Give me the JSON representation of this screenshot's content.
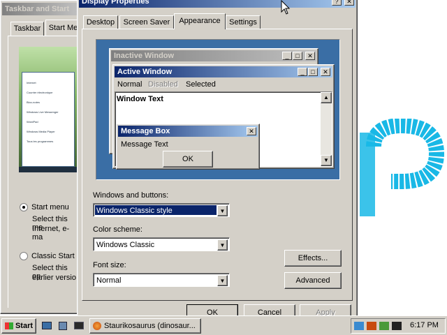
{
  "background_window": {
    "title": "Taskbar and Start",
    "tabs": [
      "Taskbar",
      "Start Me"
    ],
    "preview_menu_items": [
      "Internet",
      "Courrier électronique",
      "Bloc-notes",
      "Windows Live Messenger",
      "WordPad",
      "Windows Media Player",
      "Tous les programmes"
    ],
    "start_menu_option": "Start menu",
    "start_menu_desc_1": "Select this me",
    "start_menu_desc_2": "Internet, e-ma",
    "classic_option": "Classic Start",
    "classic_desc_1": "Select this op",
    "classic_desc_2": "earlier versio"
  },
  "dialog": {
    "title": "Display Properties",
    "tabs": [
      "Desktop",
      "Screen Saver",
      "Appearance",
      "Settings"
    ],
    "active_tab": "Appearance",
    "preview": {
      "inactive_title": "Inactive Window",
      "active_title": "Active Window",
      "menu_normal": "Normal",
      "menu_disabled": "Disabled",
      "menu_selected": "Selected",
      "window_text": "Window Text",
      "message_box_title": "Message Box",
      "message_text": "Message Text",
      "ok_label": "OK"
    },
    "windows_buttons_label": "Windows and buttons:",
    "windows_buttons_value": "Windows Classic style",
    "color_scheme_label": "Color scheme:",
    "color_scheme_value": "Windows Classic",
    "font_size_label": "Font size:",
    "font_size_value": "Normal",
    "effects_label": "Effects...",
    "advanced_label": "Advanced",
    "ok_label": "OK",
    "cancel_label": "Cancel",
    "apply_label": "Apply"
  },
  "taskbar": {
    "start_label": "Start",
    "task_label": "Staurikosaurus (dinosaur...",
    "clock": "6:17 PM"
  },
  "colors": {
    "face": "#d4d0c8",
    "active_title": "#0a246a",
    "desktop_blue": "#3a6ea5",
    "logo_cyan": "#19b8e6"
  }
}
